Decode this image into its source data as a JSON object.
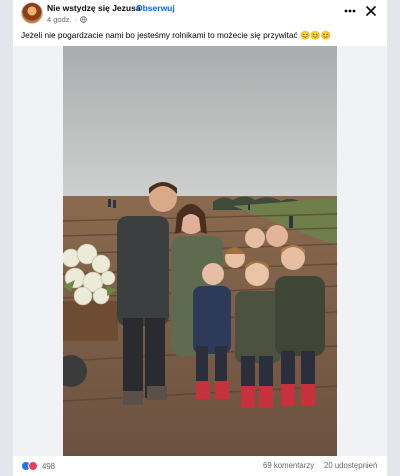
{
  "post": {
    "page_name": "Nie wstydzę się Jezusa",
    "separator": "·",
    "follow_label": "Obserwuj",
    "time": "4 godz.",
    "time_sep": "·",
    "caption": "Jeżeli nie pogardzacie nami bo jesteśmy rolnikami to możecie się przywitać 😊😊😊",
    "icons": {
      "avatar": "avatar-jesus-image",
      "privacy": "globe-icon",
      "more": "more-dots-icon",
      "close": "close-icon",
      "like": "like-reaction-icon",
      "love": "love-reaction-icon"
    }
  },
  "footer": {
    "reaction_count": "498",
    "comments": "69 komentarzy",
    "shares": "20 udostępnień"
  },
  "colors": {
    "link": "#0866ff",
    "meta": "#65676b",
    "like": "#1877f2",
    "love": "#f33e58"
  }
}
